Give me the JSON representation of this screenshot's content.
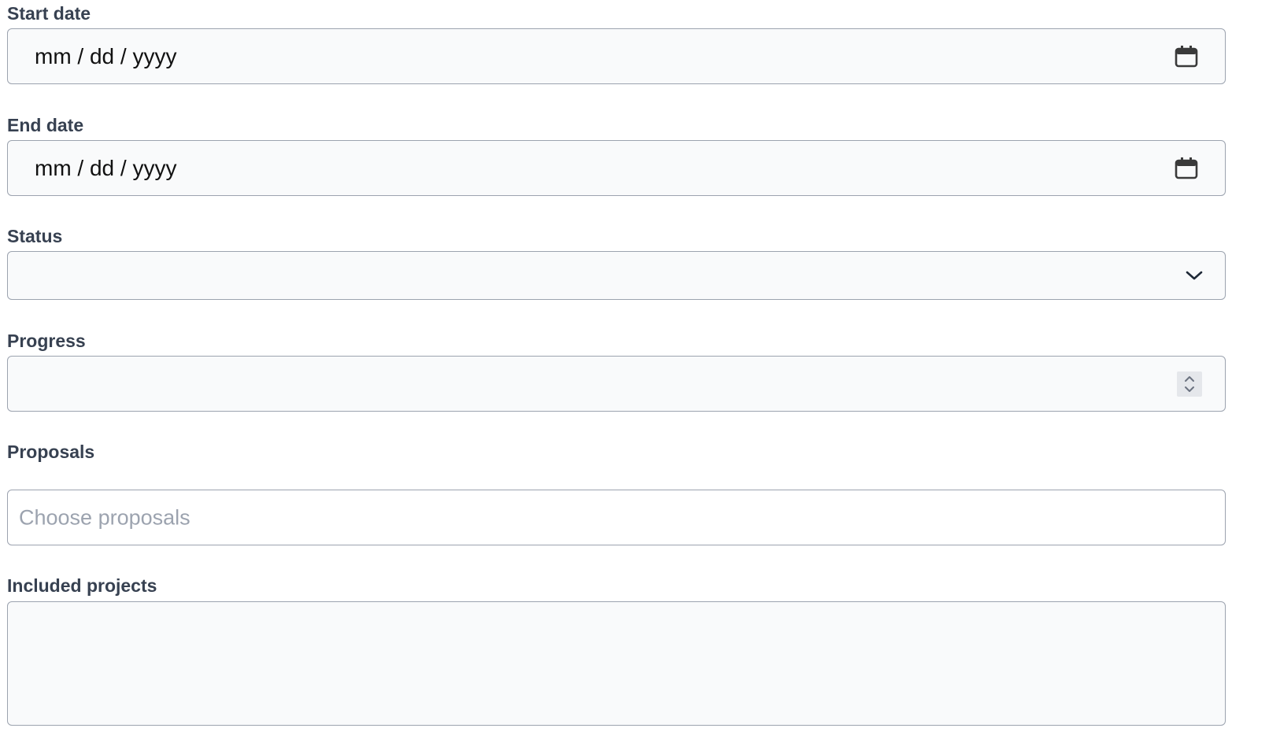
{
  "form": {
    "start_date": {
      "label": "Start date",
      "value": "mm / dd / yyyy",
      "icon": "calendar-icon"
    },
    "end_date": {
      "label": "End date",
      "value": "mm / dd / yyyy",
      "icon": "calendar-icon"
    },
    "status": {
      "label": "Status",
      "value": "",
      "icon": "chevron-down-icon"
    },
    "progress": {
      "label": "Progress",
      "value": "",
      "icon": "spinner-icon"
    },
    "proposals": {
      "label": "Proposals",
      "placeholder": "Choose proposals"
    },
    "included_projects": {
      "label": "Included projects",
      "value": ""
    }
  },
  "colors": {
    "label": "#374151",
    "border": "#9ca3af",
    "field_bg": "#f9fafb",
    "placeholder": "#9ca3af"
  }
}
